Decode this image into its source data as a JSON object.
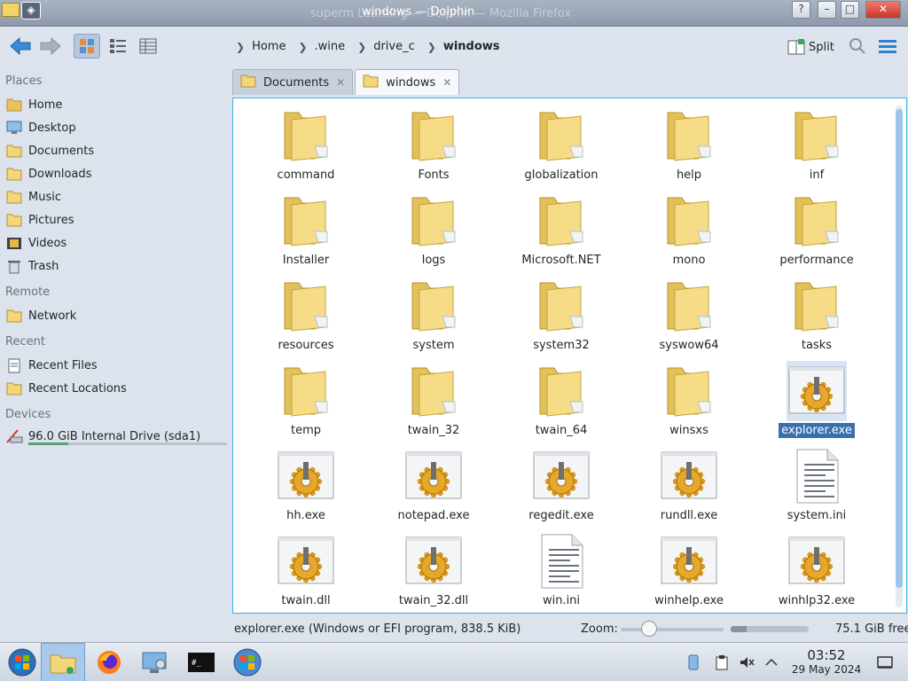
{
  "window": {
    "title": "windows — Dolphin",
    "ghost_title": "superm Learning — Dolphin — Mozilla Firefox"
  },
  "toolbar": {
    "breadcrumbs": [
      "Home",
      ".wine",
      "drive_c",
      "windows"
    ],
    "split_label": "Split"
  },
  "sidebar": {
    "places_heading": "Places",
    "places": [
      {
        "label": "Home",
        "icon": "home-folder-icon"
      },
      {
        "label": "Desktop",
        "icon": "desktop-icon"
      },
      {
        "label": "Documents",
        "icon": "documents-folder-icon"
      },
      {
        "label": "Downloads",
        "icon": "downloads-folder-icon"
      },
      {
        "label": "Music",
        "icon": "music-folder-icon"
      },
      {
        "label": "Pictures",
        "icon": "pictures-folder-icon"
      },
      {
        "label": "Videos",
        "icon": "videos-folder-icon"
      },
      {
        "label": "Trash",
        "icon": "trash-icon"
      }
    ],
    "remote_heading": "Remote",
    "remote": [
      {
        "label": "Network",
        "icon": "network-folder-icon"
      }
    ],
    "recent_heading": "Recent",
    "recent": [
      {
        "label": "Recent Files",
        "icon": "recent-files-icon"
      },
      {
        "label": "Recent Locations",
        "icon": "recent-locations-icon"
      }
    ],
    "devices_heading": "Devices",
    "devices": [
      {
        "label": "96.0 GiB Internal Drive (sda1)",
        "icon": "hard-drive-icon",
        "used_fraction": 0.2
      }
    ]
  },
  "tabs": [
    {
      "label": "Documents",
      "active": false
    },
    {
      "label": "windows",
      "active": true
    }
  ],
  "files": [
    {
      "name": "command",
      "kind": "folder"
    },
    {
      "name": "Fonts",
      "kind": "folder"
    },
    {
      "name": "globalization",
      "kind": "folder"
    },
    {
      "name": "help",
      "kind": "folder"
    },
    {
      "name": "inf",
      "kind": "folder"
    },
    {
      "name": "Installer",
      "kind": "folder"
    },
    {
      "name": "logs",
      "kind": "folder"
    },
    {
      "name": "Microsoft.NET",
      "kind": "folder"
    },
    {
      "name": "mono",
      "kind": "folder"
    },
    {
      "name": "performance",
      "kind": "folder"
    },
    {
      "name": "resources",
      "kind": "folder"
    },
    {
      "name": "system",
      "kind": "folder"
    },
    {
      "name": "system32",
      "kind": "folder"
    },
    {
      "name": "syswow64",
      "kind": "folder"
    },
    {
      "name": "tasks",
      "kind": "folder"
    },
    {
      "name": "temp",
      "kind": "folder"
    },
    {
      "name": "twain_32",
      "kind": "folder"
    },
    {
      "name": "twain_64",
      "kind": "folder"
    },
    {
      "name": "winsxs",
      "kind": "folder"
    },
    {
      "name": "explorer.exe",
      "kind": "exe",
      "selected": true
    },
    {
      "name": "hh.exe",
      "kind": "exe"
    },
    {
      "name": "notepad.exe",
      "kind": "exe"
    },
    {
      "name": "regedit.exe",
      "kind": "exe"
    },
    {
      "name": "rundll.exe",
      "kind": "exe"
    },
    {
      "name": "system.ini",
      "kind": "text"
    },
    {
      "name": "twain.dll",
      "kind": "exe"
    },
    {
      "name": "twain_32.dll",
      "kind": "exe"
    },
    {
      "name": "win.ini",
      "kind": "text"
    },
    {
      "name": "winhelp.exe",
      "kind": "exe"
    },
    {
      "name": "winhlp32.exe",
      "kind": "exe"
    }
  ],
  "statusbar": {
    "selection_info": "explorer.exe (Windows or EFI program, 838.5 KiB)",
    "zoom_label": "Zoom:",
    "zoom_level": 0.28,
    "free_space": "75.1 GiB free",
    "used_fraction": 0.2
  },
  "taskbar": {
    "time": "03:52",
    "date": "29 May 2024"
  },
  "colors": {
    "accent": "#3daee9",
    "selection": "#3a6fae",
    "folder": "#f3d67a"
  }
}
